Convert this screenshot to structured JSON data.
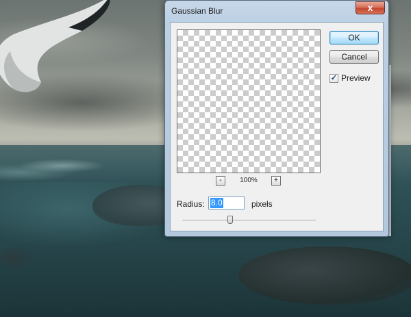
{
  "dialog": {
    "title": "Gaussian Blur",
    "close_label": "x",
    "ok_label": "OK",
    "cancel_label": "Cancel",
    "preview_label": "Preview",
    "preview_checked": true,
    "zoom_out_label": "-",
    "zoom_in_label": "+",
    "zoom_level": "100%",
    "radius_label": "Radius:",
    "radius_value": "8.0",
    "radius_unit": "pixels",
    "radius_slider_fraction": 0.36
  },
  "colors": {
    "ok_border": "#3c7fb1",
    "close_button": "#c3462d",
    "selection": "#3399ff"
  },
  "icons": {
    "close": "close-icon",
    "check": "checkmark-icon",
    "zoom_out": "minus-icon",
    "zoom_in": "plus-icon"
  }
}
